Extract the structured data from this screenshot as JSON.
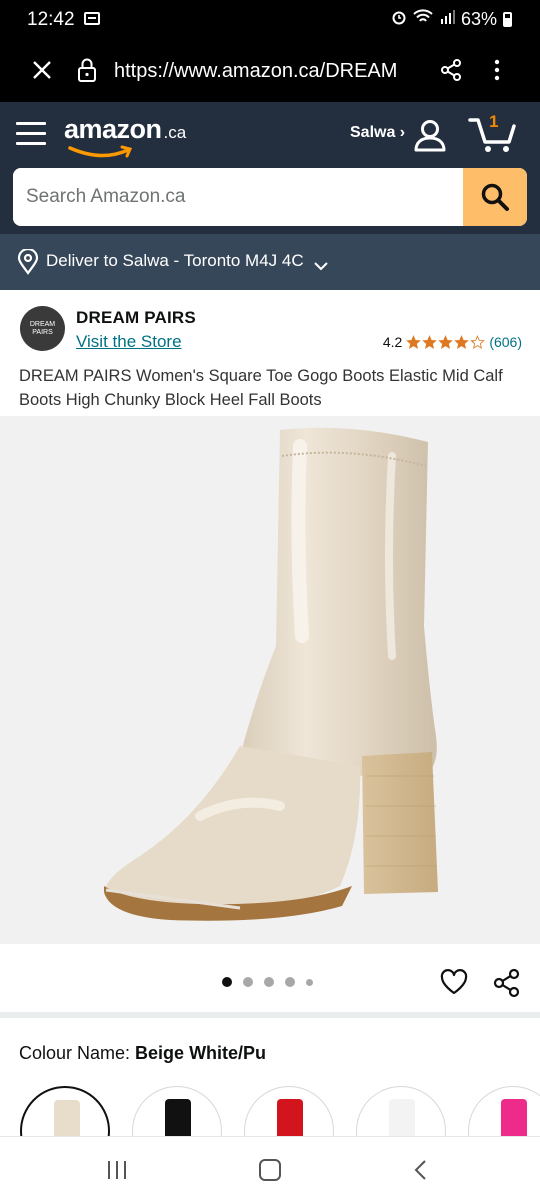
{
  "status_bar": {
    "time": "12:42",
    "battery": "63%"
  },
  "browser": {
    "url": "https://www.amazon.ca/DREAM"
  },
  "header": {
    "logo_word": "amazon",
    "logo_tld": ".ca",
    "signin_label": "Salwa ›",
    "cart_count": "1",
    "search_placeholder": "Search Amazon.ca"
  },
  "delivery": {
    "text": "Deliver to Salwa - Toronto M4J 4C"
  },
  "brand": {
    "logo_text": "DREAM PAIRS",
    "name": "DREAM PAIRS",
    "visit_store": "Visit the Store",
    "rating": "4.2",
    "rating_value": 4.2,
    "review_count": "(606)"
  },
  "product": {
    "title": "DREAM PAIRS Women's Square Toe Gogo Boots Elastic Mid Calf Boots High Chunky Block Heel Fall Boots",
    "image_count": 5,
    "active_image": 0
  },
  "colour": {
    "label": "Colour Name: ",
    "selected": "Beige White/Pu",
    "swatches": [
      {
        "name": "beige",
        "color": "#e8dccb"
      },
      {
        "name": "black",
        "color": "#111111"
      },
      {
        "name": "red",
        "color": "#d2141c"
      },
      {
        "name": "white",
        "color": "#f3f3f3"
      },
      {
        "name": "pink",
        "color": "#ee2a8a"
      }
    ]
  },
  "colors": {
    "header": "#232f3e",
    "delivery": "#37475a",
    "search_button": "#febd69",
    "link": "#007185",
    "star": "#de7921"
  }
}
